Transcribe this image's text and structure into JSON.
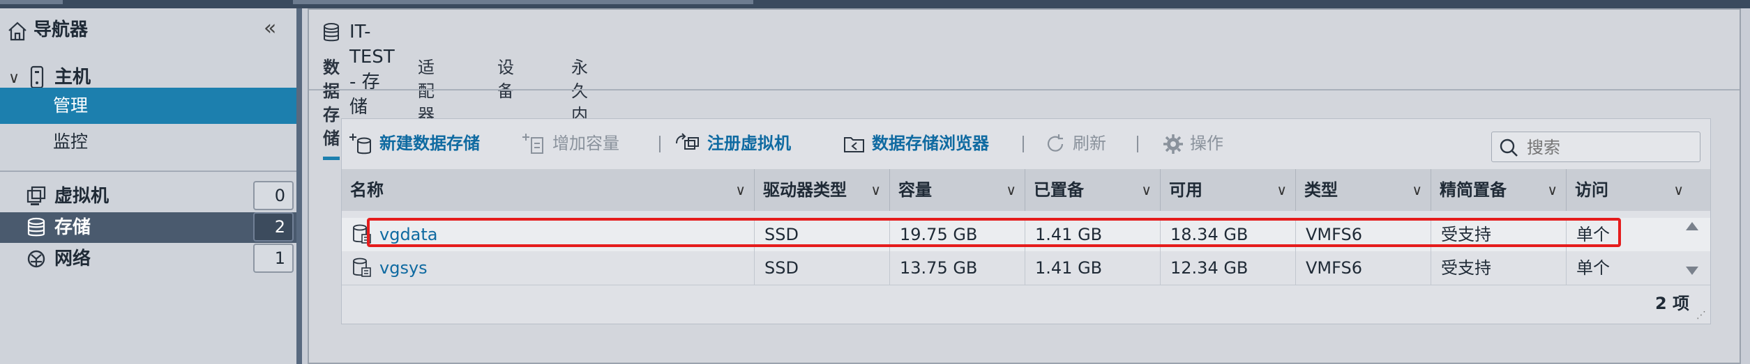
{
  "colors": {
    "accent": "#1c7fae",
    "link": "#0f6aa1",
    "highlight": "#e51c1c",
    "sidebar_dark": "#4a5a6e"
  },
  "navigator": {
    "title": "导航器",
    "host": "主机",
    "manage": "管理",
    "monitor": "监控",
    "items": [
      {
        "label": "虚拟机",
        "count": "0",
        "icon": "vm-icon"
      },
      {
        "label": "存储",
        "count": "2",
        "icon": "database-icon"
      },
      {
        "label": "网络",
        "count": "1",
        "icon": "network-icon"
      }
    ]
  },
  "header": {
    "title": "IT-TEST - 存储"
  },
  "tabs": [
    "数据存储",
    "适配器",
    "设备",
    "永久内存"
  ],
  "toolbar": {
    "new_datastore": "新建数据存储",
    "increase_capacity": "增加容量",
    "register_vm": "注册虚拟机",
    "datastore_browser": "数据存储浏览器",
    "refresh": "刷新",
    "actions": "操作",
    "search_placeholder": "搜索"
  },
  "table": {
    "columns": [
      "名称",
      "驱动器类型",
      "容量",
      "已置备",
      "可用",
      "类型",
      "精简置备",
      "访问"
    ],
    "rows": [
      {
        "name": "vgdata",
        "drive": "SSD",
        "capacity": "19.75 GB",
        "provisioned": "1.41 GB",
        "free": "18.34 GB",
        "type": "VMFS6",
        "thin": "受支持",
        "access": "单个"
      },
      {
        "name": "vgsys",
        "drive": "SSD",
        "capacity": "13.75 GB",
        "provisioned": "1.41 GB",
        "free": "12.34 GB",
        "type": "VMFS6",
        "thin": "受支持",
        "access": "单个"
      }
    ],
    "item_count": "2 项"
  }
}
